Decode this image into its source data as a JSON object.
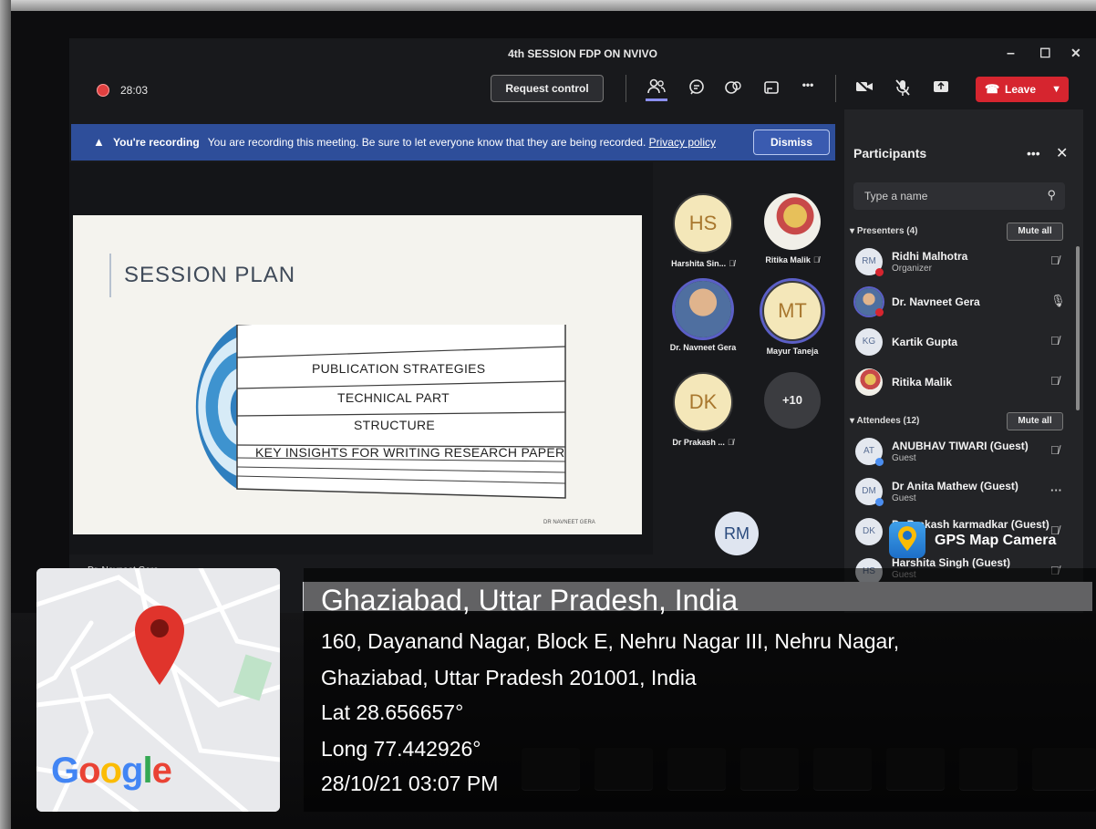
{
  "window": {
    "title": "4th SESSION FDP ON NVIVO",
    "minimize": "–",
    "maximize": "☐",
    "close": "✕"
  },
  "toolbar": {
    "timer": "28:03",
    "request_control": "Request control",
    "more": "•••",
    "leave": "Leave"
  },
  "banner": {
    "bold": "You're recording",
    "message": "You are recording this meeting. Be sure to let everyone know that they are being recorded.",
    "privacy_link": "Privacy policy",
    "dismiss": "Dismiss"
  },
  "slide": {
    "title": "SESSION PLAN",
    "items": [
      "PUBLICATION STRATEGIES",
      "TECHNICAL PART",
      "STRUCTURE",
      "KEY INSIGHTS FOR WRITING RESEARCH PAPER"
    ],
    "footer": "DR NAVNEET GERA"
  },
  "presenter_label": "Dr. Navneet Gera",
  "gallery": {
    "tiles": [
      {
        "initials": "HS",
        "name": "Harshita Sin..."
      },
      {
        "initials": "",
        "name": "Ritika Malik"
      },
      {
        "initials": "",
        "name": "Dr. Navneet Gera"
      },
      {
        "initials": "MT",
        "name": "Mayur Taneja"
      },
      {
        "initials": "DK",
        "name": "Dr Prakash ..."
      },
      {
        "initials": "+10",
        "name": ""
      }
    ],
    "self_initials": "RM"
  },
  "participants": {
    "heading": "Participants",
    "more": "•••",
    "close": "✕",
    "search_placeholder": "Type a name",
    "presenters_label": "Presenters (4)",
    "attendees_label": "Attendees (12)",
    "mute_all": "Mute all",
    "presenters": [
      {
        "initials": "RM",
        "name": "Ridhi Malhotra",
        "role": "Organizer"
      },
      {
        "initials": "",
        "name": "Dr. Navneet Gera",
        "role": ""
      },
      {
        "initials": "KG",
        "name": "Kartik Gupta",
        "role": ""
      },
      {
        "initials": "",
        "name": "Ritika Malik",
        "role": ""
      }
    ],
    "attendees": [
      {
        "initials": "AT",
        "name": "ANUBHAV TIWARI (Guest)",
        "role": "Guest"
      },
      {
        "initials": "DM",
        "name": "Dr Anita Mathew (Guest)",
        "role": "Guest"
      },
      {
        "initials": "DK",
        "name": "Dr Prakash karmadkar (Guest)",
        "role": ""
      },
      {
        "initials": "HS",
        "name": "Harshita Singh (Guest)",
        "role": "Guest"
      }
    ]
  },
  "gps": {
    "app_name": "GPS Map Camera",
    "map_brand": "Google",
    "location_title": "Ghaziabad, Uttar Pradesh, India",
    "address_line1": "160, Dayanand Nagar, Block E, Nehru Nagar III, Nehru Nagar,",
    "address_line2": "Ghaziabad, Uttar Pradesh 201001, India",
    "lat": "Lat 28.656657°",
    "long": "Long 77.442926°",
    "datetime": "28/10/21 03:07 PM"
  },
  "colors": {
    "teams_bg": "#18191c",
    "banner": "#2e4e9a",
    "leave": "#d6252f",
    "accent": "#5b5fc7",
    "pin": "#e0342c"
  }
}
